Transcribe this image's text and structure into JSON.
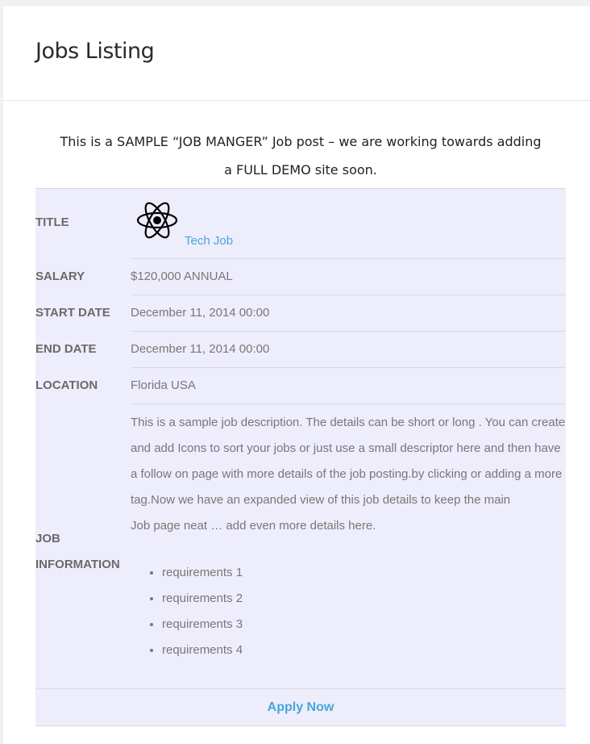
{
  "page": {
    "title": "Jobs Listing"
  },
  "intro": {
    "line1": "This is a SAMPLE “JOB MANGER” Job post – we are working towards adding",
    "line2": "a FULL DEMO site soon."
  },
  "job": {
    "title_label": "TITLE",
    "title_icon": "atom-icon",
    "title_value": "Tech Job",
    "salary_label": "SALARY",
    "salary_value": "$120,000 ANNUAL",
    "start_label": "START DATE",
    "start_value": "December 11, 2014 00:00",
    "end_label": "END DATE",
    "end_value": "December 11, 2014 00:00",
    "location_label": "LOCATION",
    "location_value": "Florida USA",
    "info_label_line1": "JOB",
    "info_label_line2": "INFORMATION",
    "description_lines": [
      "This is a sample job description. The details can be short or long . You can create",
      "and add Icons to sort your jobs or just use a small descriptor here  and then have",
      "a follow on page with more details of the job posting.by clicking or adding a more",
      " tag.Now we have an expanded view of this job details to keep the main",
      "Job page neat … add even more details here."
    ],
    "requirements": [
      "requirements 1",
      "requirements 2",
      "requirements 3",
      "requirements 4"
    ],
    "apply_label": "Apply Now"
  },
  "colors": {
    "card_background": "#eeedfc",
    "link": "#45a6d8",
    "label": "#6a6a6a",
    "value": "#777777"
  }
}
